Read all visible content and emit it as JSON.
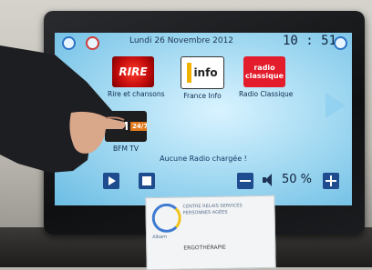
{
  "topbar": {
    "date": "Lundi 26 Novembre 2012",
    "clock": "10 : 51"
  },
  "stations": [
    {
      "label": "Rire et chansons",
      "logo_text": "RIRE"
    },
    {
      "label": "France Info",
      "logo_text": "info"
    },
    {
      "label": "Radio Classique",
      "logo_text": "radio classique"
    },
    {
      "label": "BFM TV",
      "logo_text": "BFM",
      "logo_side": "24/7"
    }
  ],
  "status": "Aucune Radio chargée !",
  "volume": "50 %",
  "card": {
    "line1": "CENTRE RELAIS SERVICES",
    "line2": "PERSONNES AGÉES",
    "line3": "Albarn",
    "line4": "ERGOTHÉRAPIE"
  },
  "colors": {
    "screen": "#a8dcf3",
    "control": "#1f4c8f",
    "bezel": "#0f1012"
  }
}
